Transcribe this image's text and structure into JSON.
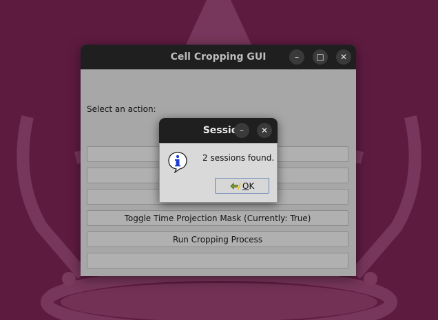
{
  "main_window": {
    "title": "Cell Cropping GUI",
    "controls": {
      "minimize": "–",
      "maximize": "□",
      "close": "✕"
    },
    "prompt": "Select an action:",
    "buttons": [
      {
        "label": ""
      },
      {
        "label": ""
      },
      {
        "label": ""
      },
      {
        "label": "Toggle Time Projection Mask (Currently: True)"
      },
      {
        "label": "Run Cropping Process"
      },
      {
        "label": ""
      }
    ]
  },
  "dialog": {
    "title": "Sessio...",
    "controls": {
      "minimize": "–",
      "close": "✕"
    },
    "message": "2 sessions found.",
    "ok_mnemonic": "O",
    "ok_rest": "K"
  },
  "icons": {
    "dialog": "info-icon",
    "ok": "check-arrow-icon"
  },
  "colors": {
    "wallpaper": "#5e1b40",
    "titlebar": "#1f1f1f",
    "window_bg": "#a7a7a7"
  }
}
